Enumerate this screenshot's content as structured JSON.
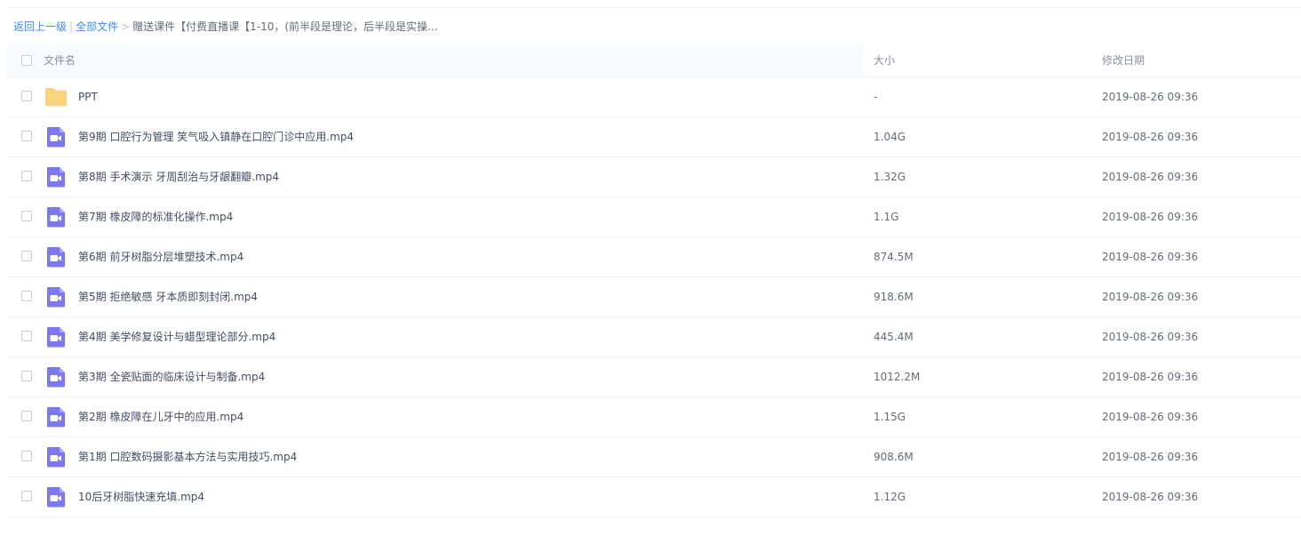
{
  "breadcrumb": {
    "back_label": "返回上一级",
    "separator1": "|",
    "all_files_label": "全部文件",
    "separator2": ">",
    "current_label": "赠送课件【付费直播课【1-10，(前半段是理论，后半段是实操..."
  },
  "table": {
    "headers": {
      "name": "文件名",
      "size": "大小",
      "date": "修改日期"
    },
    "rows": [
      {
        "type": "folder",
        "name": "PPT",
        "size": "-",
        "date": "2019-08-26 09:36"
      },
      {
        "type": "video",
        "name": "第9期 口腔行为管理 笑气吸入镇静在口腔门诊中应用.mp4",
        "size": "1.04G",
        "date": "2019-08-26 09:36"
      },
      {
        "type": "video",
        "name": "第8期 手术演示 牙周刮治与牙龈翻瓣.mp4",
        "size": "1.32G",
        "date": "2019-08-26 09:36"
      },
      {
        "type": "video",
        "name": "第7期 橡皮障的标准化操作.mp4",
        "size": "1.1G",
        "date": "2019-08-26 09:36"
      },
      {
        "type": "video",
        "name": "第6期 前牙树脂分层堆塑技术.mp4",
        "size": "874.5M",
        "date": "2019-08-26 09:36"
      },
      {
        "type": "video",
        "name": "第5期 拒绝敏感 牙本质即刻封闭.mp4",
        "size": "918.6M",
        "date": "2019-08-26 09:36"
      },
      {
        "type": "video",
        "name": "第4期 美学修复设计与蜡型理论部分.mp4",
        "size": "445.4M",
        "date": "2019-08-26 09:36"
      },
      {
        "type": "video",
        "name": "第3期 全瓷贴面的临床设计与制备.mp4",
        "size": "1012.2M",
        "date": "2019-08-26 09:36"
      },
      {
        "type": "video",
        "name": "第2期 橡皮障在儿牙中的应用.mp4",
        "size": "1.15G",
        "date": "2019-08-26 09:36"
      },
      {
        "type": "video",
        "name": "第1期 口腔数码摄影基本方法与实用技巧.mp4",
        "size": "908.6M",
        "date": "2019-08-26 09:36"
      },
      {
        "type": "video",
        "name": "10后牙树脂快速充填.mp4",
        "size": "1.12G",
        "date": "2019-08-26 09:36"
      }
    ]
  },
  "icons": {
    "folder": "folder-icon",
    "video": "video-file-icon"
  },
  "colors": {
    "link": "#3b8cff",
    "folder": "#f9d27d",
    "video": "#7b78f0"
  }
}
